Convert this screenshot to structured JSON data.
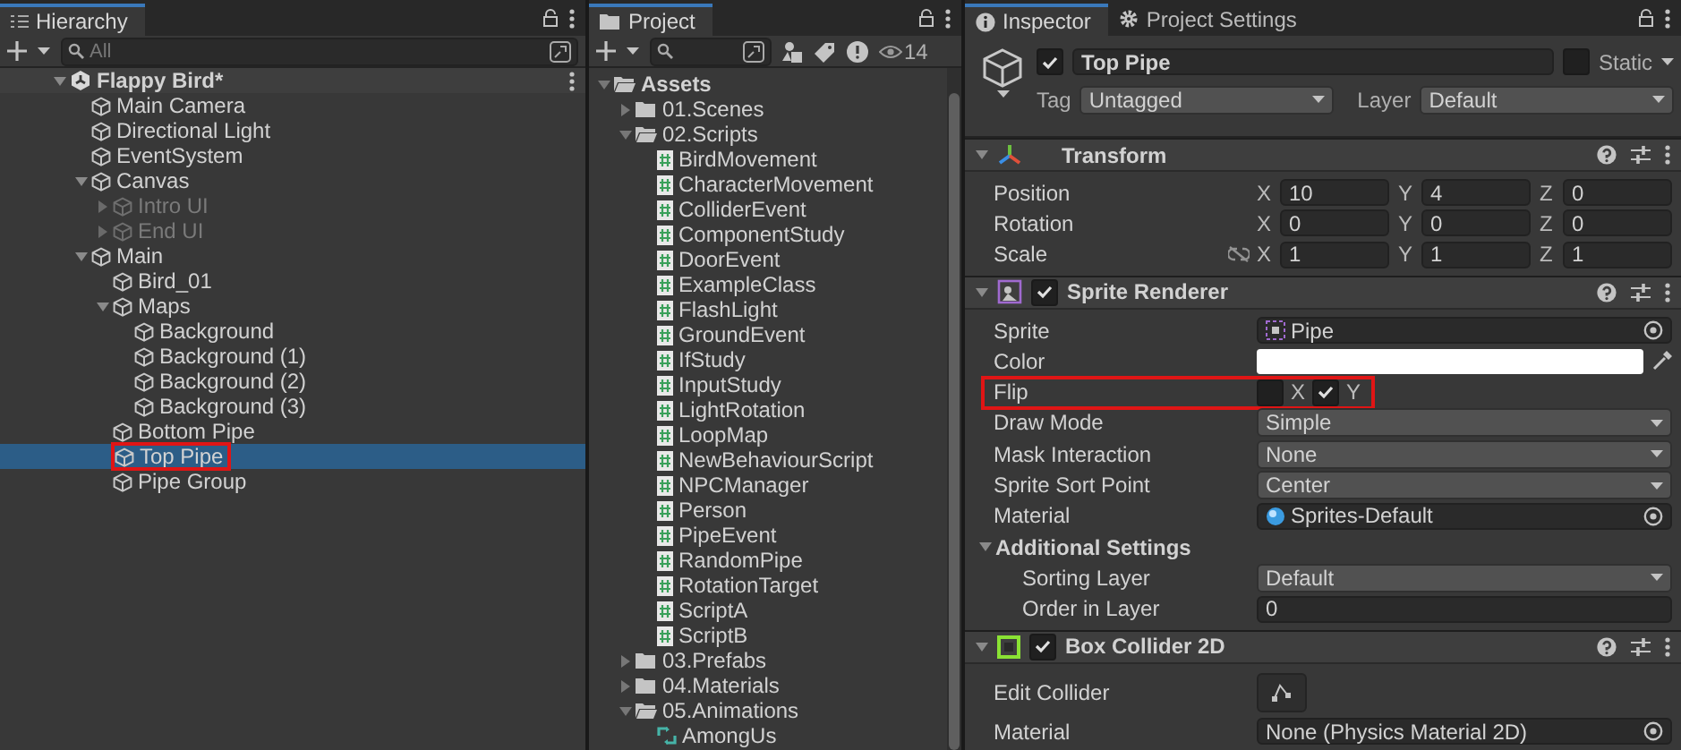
{
  "hierarchy": {
    "tab": "Hierarchy",
    "search_placeholder": "All",
    "scene": {
      "name": "Flappy Bird*",
      "expanded": true,
      "children": [
        {
          "name": "Main Camera",
          "active": true,
          "selected": false
        },
        {
          "name": "Directional Light",
          "active": true,
          "selected": false
        },
        {
          "name": "EventSystem",
          "active": true,
          "selected": false
        },
        {
          "name": "Canvas",
          "active": true,
          "selected": false,
          "expanded": true,
          "children": [
            {
              "name": "Intro UI",
              "active": false,
              "selected": false,
              "expanded": false
            },
            {
              "name": "End UI",
              "active": false,
              "selected": false,
              "expanded": false
            }
          ]
        },
        {
          "name": "Main",
          "active": true,
          "selected": false,
          "expanded": true,
          "children": [
            {
              "name": "Bird_01",
              "active": true,
              "selected": false
            },
            {
              "name": "Maps",
              "active": true,
              "selected": false,
              "expanded": true,
              "children": [
                {
                  "name": "Background",
                  "active": true,
                  "selected": false
                },
                {
                  "name": "Background (1)",
                  "active": true,
                  "selected": false
                },
                {
                  "name": "Background (2)",
                  "active": true,
                  "selected": false
                },
                {
                  "name": "Background (3)",
                  "active": true,
                  "selected": false
                }
              ]
            },
            {
              "name": "Bottom Pipe",
              "active": true,
              "selected": false
            },
            {
              "name": "Top Pipe",
              "active": true,
              "selected": true,
              "highlighted": true
            },
            {
              "name": "Pipe Group",
              "active": true,
              "selected": false
            }
          ]
        }
      ]
    }
  },
  "project": {
    "tab": "Project",
    "hidden_count": "14",
    "tree": [
      {
        "name": "Assets",
        "kind": "folder",
        "expanded": true,
        "children": [
          {
            "name": "01.Scenes",
            "kind": "folder",
            "expanded": false
          },
          {
            "name": "02.Scripts",
            "kind": "folder",
            "expanded": true,
            "children": [
              {
                "name": "BirdMovement",
                "kind": "script"
              },
              {
                "name": "CharacterMovement",
                "kind": "script"
              },
              {
                "name": "ColliderEvent",
                "kind": "script"
              },
              {
                "name": "ComponentStudy",
                "kind": "script"
              },
              {
                "name": "DoorEvent",
                "kind": "script"
              },
              {
                "name": "ExampleClass",
                "kind": "script"
              },
              {
                "name": "FlashLight",
                "kind": "script"
              },
              {
                "name": "GroundEvent",
                "kind": "script"
              },
              {
                "name": "IfStudy",
                "kind": "script"
              },
              {
                "name": "InputStudy",
                "kind": "script"
              },
              {
                "name": "LightRotation",
                "kind": "script"
              },
              {
                "name": "LoopMap",
                "kind": "script"
              },
              {
                "name": "NewBehaviourScript",
                "kind": "script"
              },
              {
                "name": "NPCManager",
                "kind": "script"
              },
              {
                "name": "Person",
                "kind": "script"
              },
              {
                "name": "PipeEvent",
                "kind": "script"
              },
              {
                "name": "RandomPipe",
                "kind": "script"
              },
              {
                "name": "RotationTarget",
                "kind": "script"
              },
              {
                "name": "ScriptA",
                "kind": "script"
              },
              {
                "name": "ScriptB",
                "kind": "script"
              }
            ]
          },
          {
            "name": "03.Prefabs",
            "kind": "folder",
            "expanded": false
          },
          {
            "name": "04.Materials",
            "kind": "folder",
            "expanded": false
          },
          {
            "name": "05.Animations",
            "kind": "folder",
            "expanded": true,
            "children": [
              {
                "name": "AmongUs",
                "kind": "animation"
              }
            ]
          }
        ]
      }
    ]
  },
  "inspector": {
    "tabs": [
      {
        "label": "Inspector",
        "selected": true
      },
      {
        "label": "Project Settings",
        "selected": false
      }
    ],
    "object": {
      "enabled": true,
      "name": "Top Pipe",
      "static": false,
      "static_label": "Static",
      "tag_label": "Tag",
      "tag": "Untagged",
      "layer_label": "Layer",
      "layer": "Default"
    },
    "components": [
      {
        "name": "Transform",
        "kind": "transform",
        "expanded": true,
        "rows": [
          {
            "kind": "vector3",
            "label": "Position",
            "values": [
              {
                "axis": "X",
                "value": "10"
              },
              {
                "axis": "Y",
                "value": "4"
              },
              {
                "axis": "Z",
                "value": "0"
              }
            ]
          },
          {
            "kind": "vector3",
            "label": "Rotation",
            "values": [
              {
                "axis": "X",
                "value": "0"
              },
              {
                "axis": "Y",
                "value": "0"
              },
              {
                "axis": "Z",
                "value": "0"
              }
            ]
          },
          {
            "kind": "vector3",
            "label": "Scale",
            "linked": false,
            "values": [
              {
                "axis": "X",
                "value": "1"
              },
              {
                "axis": "Y",
                "value": "1"
              },
              {
                "axis": "Z",
                "value": "1"
              }
            ]
          }
        ]
      },
      {
        "name": "Sprite Renderer",
        "kind": "sprite",
        "expanded": true,
        "enabled": true,
        "rows": [
          {
            "kind": "sprite_object",
            "label": "Sprite",
            "value": "Pipe"
          },
          {
            "kind": "color",
            "label": "Color",
            "color": "#ffffff"
          },
          {
            "kind": "flip",
            "label": "Flip",
            "highlighted": true,
            "options": [
              {
                "label": "X",
                "checked": false
              },
              {
                "label": "Y",
                "checked": true
              }
            ]
          },
          {
            "kind": "dropdown",
            "label": "Draw Mode",
            "value": "Simple"
          },
          {
            "kind": "dropdown",
            "label": "Mask Interaction",
            "value": "None"
          },
          {
            "kind": "dropdown",
            "label": "Sprite Sort Point",
            "value": "Center"
          },
          {
            "kind": "material_object",
            "label": "Material",
            "value": "Sprites-Default"
          },
          {
            "kind": "foldout",
            "label": "Additional Settings",
            "expanded": true,
            "children": [
              {
                "kind": "dropdown",
                "label": "Sorting Layer",
                "value": "Default"
              },
              {
                "kind": "number",
                "label": "Order in Layer",
                "value": "0"
              }
            ]
          }
        ]
      },
      {
        "name": "Box Collider 2D",
        "kind": "collider",
        "expanded": true,
        "enabled": true,
        "rows": [
          {
            "kind": "button",
            "label": "Edit Collider"
          },
          {
            "kind": "object",
            "label": "Material",
            "value": "None (Physics Material 2D)"
          }
        ]
      }
    ]
  }
}
